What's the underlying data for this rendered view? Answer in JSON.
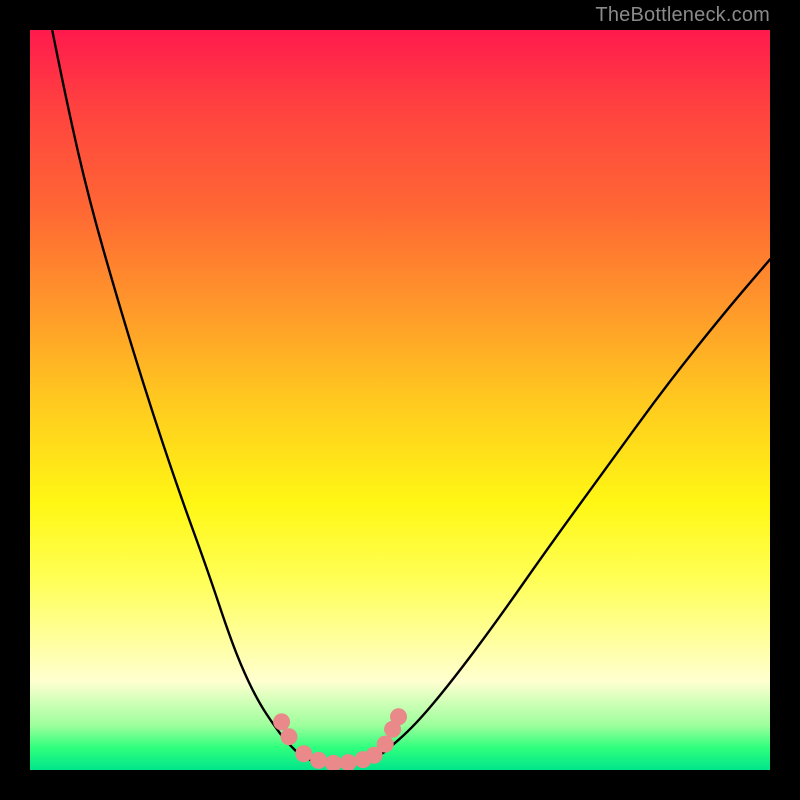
{
  "watermark": "TheBottleneck.com",
  "colors": {
    "background": "#000000",
    "curve": "#000000",
    "marker_fill": "#e98989",
    "marker_stroke": "#d87070"
  },
  "chart_data": {
    "type": "line",
    "title": "",
    "xlabel": "",
    "ylabel": "",
    "xlim": [
      0,
      100
    ],
    "ylim": [
      0,
      100
    ],
    "grid": false,
    "legend": false,
    "notes": "V-shaped bottleneck curve on rainbow gradient. No axis ticks or numeric labels shown.",
    "series": [
      {
        "name": "left-arm",
        "x": [
          3,
          5,
          8,
          12,
          16,
          20,
          24,
          27,
          29,
          31,
          33,
          34.5,
          36
        ],
        "y": [
          100,
          90,
          77,
          63,
          50,
          38,
          27,
          18,
          13,
          9,
          6,
          4,
          2.5
        ]
      },
      {
        "name": "valley",
        "x": [
          36,
          38,
          40,
          42,
          44,
          46,
          48
        ],
        "y": [
          2.5,
          1.2,
          0.8,
          0.6,
          0.8,
          1.2,
          2.5
        ]
      },
      {
        "name": "right-arm",
        "x": [
          48,
          52,
          57,
          63,
          70,
          78,
          86,
          94,
          100
        ],
        "y": [
          2.5,
          6,
          12,
          20,
          30,
          41,
          52,
          62,
          69
        ]
      }
    ],
    "markers": [
      {
        "x": 34,
        "y": 6.5
      },
      {
        "x": 35,
        "y": 4.5
      },
      {
        "x": 37,
        "y": 2.2
      },
      {
        "x": 39,
        "y": 1.3
      },
      {
        "x": 41,
        "y": 0.9
      },
      {
        "x": 43,
        "y": 1.0
      },
      {
        "x": 45,
        "y": 1.4
      },
      {
        "x": 46.5,
        "y": 2.0
      },
      {
        "x": 48,
        "y": 3.5
      },
      {
        "x": 49,
        "y": 5.5
      },
      {
        "x": 49.8,
        "y": 7.2
      }
    ]
  }
}
